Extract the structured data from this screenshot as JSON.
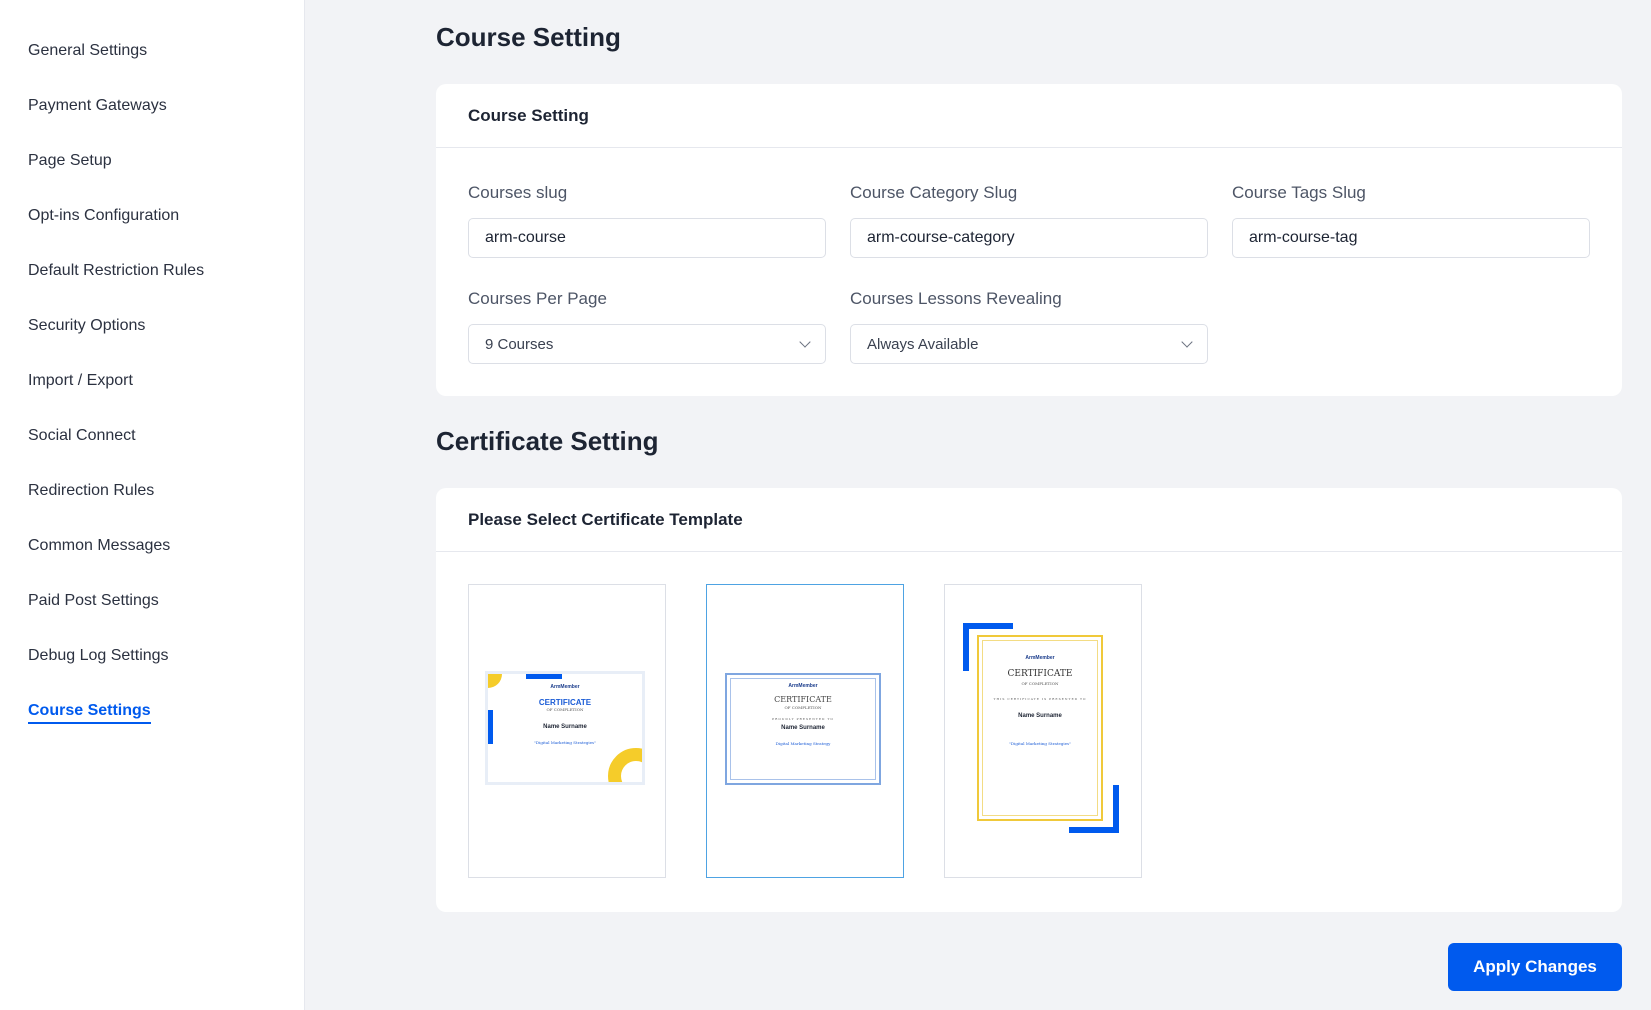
{
  "sidebar": {
    "items": [
      {
        "label": "General Settings"
      },
      {
        "label": "Payment Gateways"
      },
      {
        "label": "Page Setup"
      },
      {
        "label": "Opt-ins Configuration"
      },
      {
        "label": "Default Restriction Rules"
      },
      {
        "label": "Security Options"
      },
      {
        "label": "Import / Export"
      },
      {
        "label": "Social Connect"
      },
      {
        "label": "Redirection Rules"
      },
      {
        "label": "Common Messages"
      },
      {
        "label": "Paid Post Settings"
      },
      {
        "label": "Debug Log Settings"
      },
      {
        "label": "Course Settings"
      }
    ],
    "active_index": 12
  },
  "course": {
    "page_title": "Course Setting",
    "card_title": "Course Setting",
    "fields": {
      "courses_slug": {
        "label": "Courses slug",
        "value": "arm-course"
      },
      "category_slug": {
        "label": "Course Category Slug",
        "value": "arm-course-category"
      },
      "tags_slug": {
        "label": "Course Tags Slug",
        "value": "arm-course-tag"
      },
      "per_page": {
        "label": "Courses Per Page",
        "value": "9 Courses"
      },
      "lessons_revealing": {
        "label": "Courses Lessons Revealing",
        "value": "Always Available"
      }
    }
  },
  "certificate": {
    "page_title": "Certificate Setting",
    "card_title": "Please Select Certificate Template",
    "selected_index": 1,
    "templates": [
      {
        "brand": "ArmMember",
        "title": "CERTIFICATE",
        "subtitle": "OF COMPLETION",
        "name": "Name Surname",
        "course": "\"Digital Marketing Strategies\""
      },
      {
        "brand": "ArmMember",
        "title": "CERTIFICATE",
        "subtitle": "OF COMPLETION",
        "presented": "PROUDLY PRESENTED TO",
        "name": "Name Surname",
        "course": "Digital Marketing Strategy"
      },
      {
        "brand": "ArmMember",
        "title": "CERTIFICATE",
        "subtitle": "OF COMPLETION",
        "presented": "THIS CERTIFICATE IS PRESENTED TO",
        "name": "Name Surname",
        "course": "\"Digital Marketing Strategies\""
      }
    ]
  },
  "actions": {
    "apply_label": "Apply Changes"
  },
  "colors": {
    "accent": "#005aee",
    "yellow": "#f5cc2a",
    "selected_border": "#4ea3e3",
    "background": "#f2f3f6"
  }
}
